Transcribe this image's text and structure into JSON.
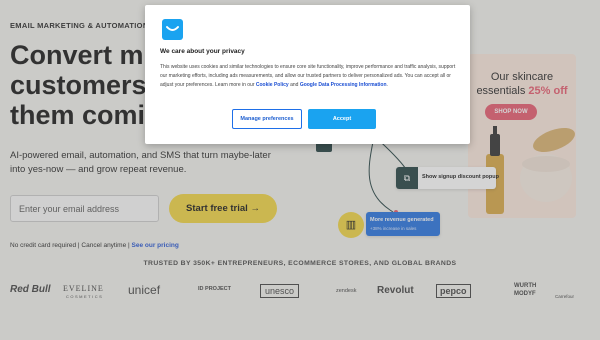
{
  "hero": {
    "eyebrow": "EMAIL MARKETING & AUTOMATION PL",
    "headline_lines": [
      "Convert m",
      "customers",
      "them comi"
    ],
    "subtext_1": "AI-powered email, automation, and SMS that turn maybe-later",
    "subtext_2": "into yes-now — and grow repeat revenue.",
    "email_placeholder": "Enter your email address",
    "cta_label": "Start free trial →",
    "disclaimer": "No credit card required | Cancel anytime | ",
    "pricing_link": "See our pricing"
  },
  "illustration": {
    "promo_line1": "Our skincare",
    "promo_line2": "essentials ",
    "promo_discount": "25% off",
    "promo_button": "SHOP NOW",
    "signup_label": "Show signup discount popup",
    "revenue_title": "More revenue generated",
    "revenue_sub": "+38% increase in sales"
  },
  "trusted": {
    "heading": "TRUSTED BY 350K+ ENTREPRENEURS, ECOMMERCE STORES, AND GLOBAL BRANDS",
    "logos": [
      "Red Bull",
      "EVELINE",
      "COSMETICS",
      "unicef",
      "ID PROJECT",
      "unesco",
      "zendesk",
      "Revolut",
      "pepco",
      "WURTH",
      "MODYF",
      "Carrefour"
    ]
  },
  "cookie_dialog": {
    "title": "We care about your privacy",
    "body": "This website uses cookies and similar technologies to ensure core site functionality, improve performance and traffic analysis, support our marketing efforts, including ads measurements, and allow our trusted partners to deliver personalized ads. You can accept all or adjust your preferences. Learn more in our ",
    "cookie_policy": "Cookie Policy",
    "and": " and ",
    "google_policy": "Google Data Processing Information",
    "period": ".",
    "manage_label": "Manage preferences",
    "accept_label": "Accept"
  },
  "colors": {
    "brand_blue": "#1aa3f0",
    "cta_yellow": "#f2d43d",
    "promo_pink": "#e8566a",
    "link_blue": "#1c4fd3"
  }
}
